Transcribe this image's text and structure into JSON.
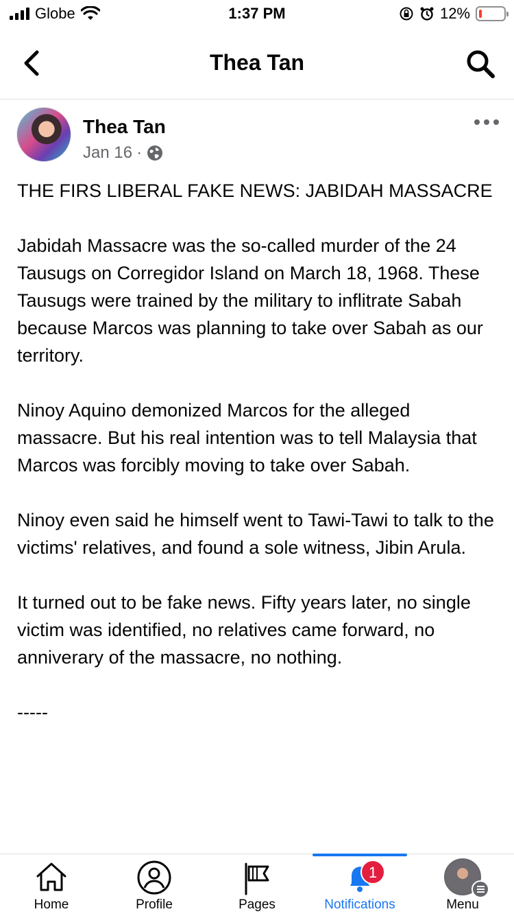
{
  "status_bar": {
    "carrier": "Globe",
    "time": "1:37 PM",
    "battery": "12%"
  },
  "header": {
    "title": "Thea Tan"
  },
  "post": {
    "author": "Thea Tan",
    "date": "Jan 16",
    "separator": "·",
    "paragraphs": [
      "THE FIRS LIBERAL FAKE NEWS: JABIDAH MASSACRE",
      "Jabidah Massacre was the so-called murder of the 24 Tausugs on Corregidor Island on March 18, 1968. These Tausugs were trained by the military to inflitrate Sabah because Marcos was planning to take over Sabah as our territory.",
      "Ninoy Aquino demonized Marcos for the alleged massacre. But his real intention was to tell Malaysia that Marcos was forcibly moving to take over Sabah.",
      "Ninoy even said he himself went to Tawi-Tawi to talk to the victims' relatives, and found a sole witness, Jibin Arula.",
      "It turned out to be fake news. Fifty years later, no single victim was identified, no relatives came forward, no anniverary of the massacre, no nothing.",
      "-----"
    ]
  },
  "tab_bar": {
    "tabs": [
      {
        "label": "Home",
        "icon": "home-icon"
      },
      {
        "label": "Profile",
        "icon": "profile-icon"
      },
      {
        "label": "Pages",
        "icon": "flag-icon"
      },
      {
        "label": "Notifications",
        "icon": "bell-icon",
        "badge": "1",
        "active": true
      },
      {
        "label": "Menu",
        "icon": "menu-avatar"
      }
    ]
  },
  "colors": {
    "accent": "#1877f2",
    "badge": "#e41e3f",
    "secondary_text": "#65676b",
    "battery_low": "#ff3b30"
  }
}
